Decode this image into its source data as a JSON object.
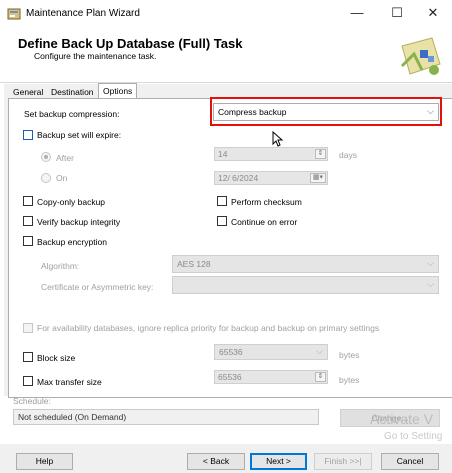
{
  "window": {
    "title": "Maintenance Plan Wizard",
    "minimize": "—",
    "maximize": "☐",
    "close": "✕",
    "icon": "wizard-icon"
  },
  "header": {
    "title": "Define Back Up Database (Full) Task",
    "subtitle": "Configure the maintenance task."
  },
  "tabs": [
    {
      "label": "General",
      "active": false
    },
    {
      "label": "Destination",
      "active": false
    },
    {
      "label": "Options",
      "active": true
    }
  ],
  "options": {
    "compression_label": "Set backup compression:",
    "compression_value": "Compress backup",
    "expire_label": "Backup set will expire:",
    "after_label": "After",
    "after_value": "14",
    "days_label": "days",
    "on_label": "On",
    "on_value": "12/ 6/2024",
    "copy_only_label": "Copy-only backup",
    "perform_checksum_label": "Perform checksum",
    "verify_label": "Verify backup integrity",
    "continue_on_error_label": "Continue on error",
    "encryption_label": "Backup encryption",
    "algorithm_label": "Algorithm:",
    "algorithm_value": "AES 128",
    "certificate_label": "Certificate or Asymmetric key:",
    "certificate_value": "",
    "availability_label": "For availability databases, ignore replica priority for backup and backup on primary settings",
    "block_size_label": "Block size",
    "block_size_value": "65536",
    "block_size_unit": "bytes",
    "max_transfer_label": "Max transfer size",
    "max_transfer_value": "65536",
    "max_transfer_unit": "bytes"
  },
  "schedule": {
    "label": "Schedule:",
    "value": "Not scheduled (On Demand)",
    "change_label": "Change..."
  },
  "watermark": {
    "line1": "Activate V",
    "line2": "Go to Setting"
  },
  "buttons": {
    "help": "Help",
    "back": "< Back",
    "next": "Next >",
    "finish": "Finish >>|",
    "cancel": "Cancel"
  },
  "colors": {
    "highlight": "#e31010",
    "accent": "#0078d7"
  }
}
